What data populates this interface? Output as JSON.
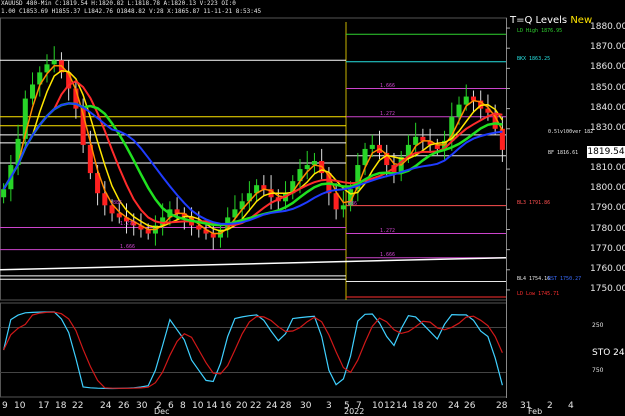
{
  "header": {
    "line1": "XAUUSD 480-Min C:1819.54 H:1820.82 L:1818.78 A:1820.13 V:223 OI:0",
    "line2": "1.00 C1853.69 H1855.37 L1842.76 O1848.82 V:28 X:1865.87 11-11-21 8:53:45"
  },
  "legend": {
    "prefix": "T=Q Levels ",
    "suffix": "New"
  },
  "price_label": "1819.54",
  "y_ticks": [
    "1880.00",
    "1870.00",
    "1860.00",
    "1850.00",
    "1840.00",
    "1830.00",
    "1810.00",
    "1800.00",
    "1790.00",
    "1780.00",
    "1770.00",
    "1760.00",
    "1750.00"
  ],
  "levels": [
    {
      "text": "LD High 1876.95",
      "color": "#2fd22f"
    },
    {
      "text": "BKX 1863.25",
      "color": "#26e0e0"
    },
    {
      "text": "1.666",
      "color": "#cc44cc"
    },
    {
      "text": "1.272",
      "color": "#cc44cc"
    },
    {
      "text": "0.5lvl00ver 182",
      "color": "#e8e8e8"
    },
    {
      "text": "BF 1816.61",
      "color": "#e8e8e8"
    },
    {
      "text": "BL3 1791.86",
      "color": "#ff5050"
    },
    {
      "text": "1.272",
      "color": "#cc44cc"
    },
    {
      "text": "1.666",
      "color": "#cc44cc"
    },
    {
      "text": "BL4 1754.16",
      "color": "#e8e8e8"
    },
    {
      "text": "RST 1750.27",
      "color": "#3a6cff"
    },
    {
      "text": "LD Low 1745.71",
      "color": "#ff3030"
    },
    {
      "text": "1.272",
      "color": "#cc44cc"
    },
    {
      "text": "1.666",
      "color": "#cc44cc"
    },
    {
      "text": ".886",
      "color": "#cc44cc"
    },
    {
      "text": ".886",
      "color": "#cc44cc"
    }
  ],
  "stoch": {
    "label": "STO",
    "value": "24",
    "ticks": [
      "250",
      "750"
    ]
  },
  "x_dates": [
    "9",
    "10",
    "17",
    "18",
    "22",
    "24",
    "26",
    "30",
    "2",
    "6",
    "8",
    "10",
    "14",
    "16",
    "20",
    "22",
    "24",
    "28",
    "30",
    "3",
    "5",
    "7",
    "10",
    "12",
    "14",
    "18",
    "20",
    "24",
    "26",
    "28",
    "31",
    "2",
    "4"
  ],
  "months": [
    "Dec",
    "2022",
    "Feb"
  ],
  "chart_data": {
    "type": "candlestick",
    "symbol": "XAUUSD",
    "timeframe": "480-Min",
    "ylim": [
      1745,
      1885
    ],
    "last_price": 1819.54,
    "close": [
      1800,
      1812,
      1825,
      1845,
      1852,
      1858,
      1862,
      1864,
      1858,
      1850,
      1840,
      1822,
      1808,
      1798,
      1792,
      1788,
      1786,
      1784,
      1782,
      1780,
      1778,
      1782,
      1786,
      1790,
      1788,
      1786,
      1782,
      1780,
      1778,
      1776,
      1780,
      1786,
      1790,
      1794,
      1798,
      1802,
      1800,
      1796,
      1794,
      1798,
      1804,
      1810,
      1812,
      1814,
      1808,
      1798,
      1790,
      1792,
      1800,
      1812,
      1820,
      1822,
      1818,
      1812,
      1808,
      1816,
      1822,
      1826,
      1824,
      1822,
      1820,
      1824,
      1836,
      1842,
      1846,
      1844,
      1840,
      1838,
      1830,
      1819.54
    ],
    "series": [
      {
        "name": "ma_fast",
        "color": "#ff8c00"
      },
      {
        "name": "ma_mid",
        "color": "#ffe600"
      },
      {
        "name": "ma_slow",
        "color": "#ff2b2b"
      },
      {
        "name": "ma_green",
        "color": "#20e020"
      },
      {
        "name": "ma_blue",
        "color": "#1f3cff"
      },
      {
        "name": "trend_white",
        "color": "#ffffff"
      }
    ],
    "stoch_ylim": [
      0,
      1000
    ]
  }
}
